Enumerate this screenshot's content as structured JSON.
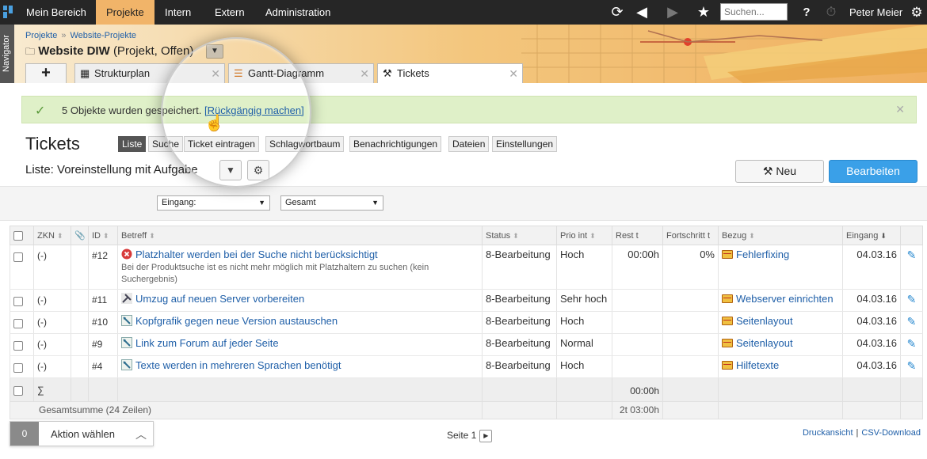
{
  "topnav": {
    "tabs": [
      "Mein Bereich",
      "Projekte",
      "Intern",
      "Extern",
      "Administration"
    ],
    "active_tab": "Projekte",
    "search_placeholder": "Suchen...",
    "user_name": "Peter Meier"
  },
  "navigator_label": "Navigator",
  "breadcrumb": [
    "Projekte",
    "Website-Projekte"
  ],
  "breadcrumb_sep": "»",
  "project": {
    "name": "Website DIW",
    "meta": "(Projekt, Offen)"
  },
  "doc_tabs": [
    {
      "label": "Strukturplan",
      "icon": "structure-icon"
    },
    {
      "label": "Gantt-Diagramm",
      "icon": "gantt-icon"
    },
    {
      "label": "Tickets",
      "icon": "tools-icon",
      "active": true
    }
  ],
  "notice": {
    "message": "5 Objekte wurden gespeichert.",
    "undo_label": "[Rückgängig machen]"
  },
  "page_title": "Tickets",
  "subtabs": [
    "Liste",
    "Suche",
    "Ticket eintragen",
    "Schlagwortbaum",
    "Benachrichtigungen",
    "Dateien",
    "Einstellungen"
  ],
  "active_subtab": "Liste",
  "list_name": "Liste: Voreinstellung mit Aufgabe",
  "buttons": {
    "new_label": "Neu",
    "edit_label": "Bearbeiten"
  },
  "filters": {
    "eingang": "Eingang:",
    "gesamt": "Gesamt"
  },
  "table": {
    "headers": {
      "zkn": "ZKN",
      "id": "ID",
      "betreff": "Betreff",
      "status": "Status",
      "prio": "Prio int",
      "rest": "Rest t",
      "fortschritt": "Fortschritt t",
      "bezug": "Bezug",
      "eingang": "Eingang"
    },
    "rows": [
      {
        "zkn": "(-)",
        "id": "#12",
        "subject": "Platzhalter werden bei der Suche nicht berücksichtigt",
        "description": "Bei der Produktsuche ist es nicht mehr möglich mit Platzhaltern zu suchen (kein Suchergebnis)",
        "icon": "error-icon",
        "status": "8-Bearbeitung",
        "prio": "Hoch",
        "prio_red": true,
        "rest": "00:00h",
        "progress": "0%",
        "bezug": "Fehlerfixing",
        "eingang": "04.03.16"
      },
      {
        "zkn": "(-)",
        "id": "#11",
        "subject": "Umzug auf neuen Server vorbereiten",
        "description": "",
        "icon": "tools-icon",
        "status": "8-Bearbeitung",
        "prio": "Sehr hoch",
        "prio_red": true,
        "rest": "",
        "progress": "",
        "bezug": "Webserver einrichten",
        "eingang": "04.03.16"
      },
      {
        "zkn": "(-)",
        "id": "#10",
        "subject": "Kopfgrafik gegen neue Version austauschen",
        "description": "",
        "icon": "task-icon",
        "status": "8-Bearbeitung",
        "prio": "Hoch",
        "prio_red": true,
        "rest": "",
        "progress": "",
        "bezug": "Seitenlayout",
        "eingang": "04.03.16"
      },
      {
        "zkn": "(-)",
        "id": "#9",
        "subject": "Link zum Forum auf jeder Seite",
        "description": "",
        "icon": "task-icon",
        "status": "8-Bearbeitung",
        "prio": "Normal",
        "prio_red": false,
        "rest": "",
        "progress": "",
        "bezug": "Seitenlayout",
        "eingang": "04.03.16"
      },
      {
        "zkn": "(-)",
        "id": "#4",
        "subject": "Texte werden in mehreren Sprachen benötigt",
        "description": "",
        "icon": "task-icon",
        "status": "8-Bearbeitung",
        "prio": "Hoch",
        "prio_red": true,
        "rest": "",
        "progress": "",
        "bezug": "Hilfetexte",
        "eingang": "04.03.16"
      }
    ],
    "sum_row": {
      "symbol": "∑",
      "rest": "00:00h"
    },
    "total_row": {
      "label": "Gesamtsumme (24 Zeilen)",
      "rest": "2t 03:00h"
    }
  },
  "action_bar": {
    "count": "0",
    "label": "Aktion wählen"
  },
  "pager": {
    "label": "Seite 1"
  },
  "footer_links": [
    "Druckansicht",
    "CSV-Download"
  ],
  "colors": {
    "accent_blue": "#3aa0e8",
    "status_red": "#c0282d",
    "notice_green": "#dff0c8",
    "active_tab": "#f1b469"
  }
}
